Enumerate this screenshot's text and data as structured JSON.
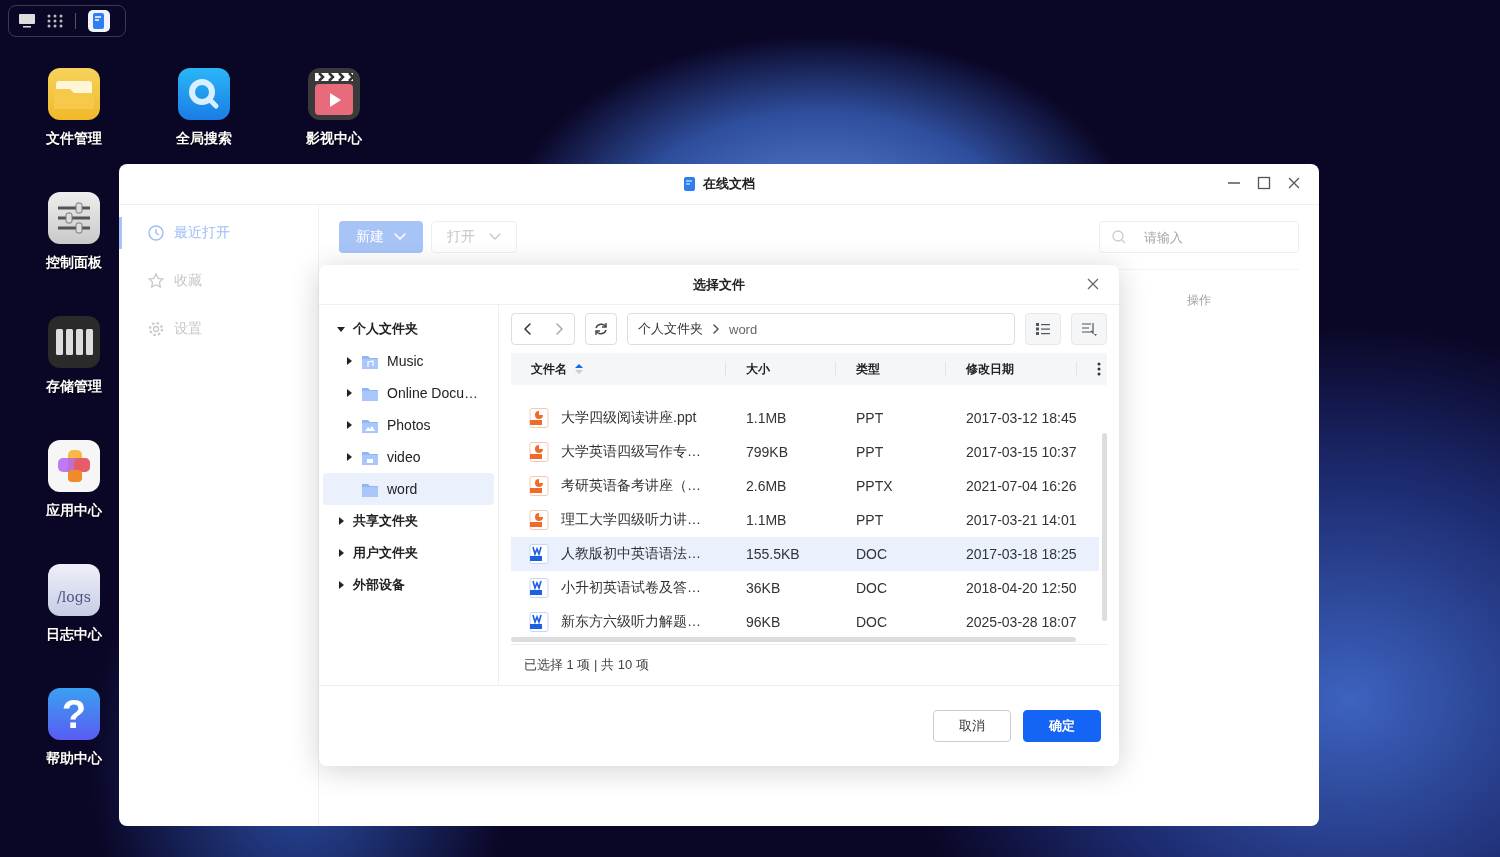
{
  "desktop_icons": [
    {
      "label": "文件管理",
      "kind": "folder"
    },
    {
      "label": "全局搜索",
      "kind": "search"
    },
    {
      "label": "影视中心",
      "kind": "video"
    },
    {
      "label": "控制面板",
      "kind": "control"
    },
    {
      "label": "存储管理",
      "kind": "storage"
    },
    {
      "label": "应用中心",
      "kind": "apps"
    },
    {
      "label": "日志中心",
      "kind": "logs",
      "text": "/logs"
    },
    {
      "label": "帮助中心",
      "kind": "help",
      "text": "?"
    }
  ],
  "window": {
    "title": "在线文档",
    "sidebar": [
      {
        "label": "最近打开",
        "kind": "clock",
        "selected": true
      },
      {
        "label": "收藏",
        "kind": "star",
        "selected": false
      },
      {
        "label": "设置",
        "kind": "gear",
        "selected": false
      }
    ],
    "new_button": "新建",
    "open_button": "打开",
    "search": {
      "placeholder": "请输入"
    },
    "table_columns": [
      "操作"
    ]
  },
  "dialog": {
    "title": "选择文件",
    "tree": [
      {
        "label": "个人文件夹",
        "expanded": true,
        "children": [
          {
            "label": "Music",
            "kind": "music",
            "expandable": true,
            "selected": false
          },
          {
            "label": "Online Docu…",
            "kind": "folder",
            "expandable": true,
            "selected": false
          },
          {
            "label": "Photos",
            "kind": "photos",
            "expandable": true,
            "selected": false
          },
          {
            "label": "video",
            "kind": "video",
            "expandable": true,
            "selected": false
          },
          {
            "label": "word",
            "kind": "folder",
            "expandable": false,
            "selected": true
          }
        ]
      },
      {
        "label": "共享文件夹",
        "expanded": false
      },
      {
        "label": "用户文件夹",
        "expanded": false
      },
      {
        "label": "外部设备",
        "expanded": false
      }
    ],
    "breadcrumb": [
      "个人文件夹",
      "word"
    ],
    "columns": [
      {
        "label": "文件名",
        "sorted": true
      },
      {
        "label": "大小",
        "sorted": false
      },
      {
        "label": "类型",
        "sorted": false
      },
      {
        "label": "修改日期",
        "sorted": false
      }
    ],
    "rows": [
      {
        "name": "大学四级阅读讲座.ppt",
        "size": "1.1MB",
        "type": "PPT",
        "date": "2017-03-12 18:45",
        "kind": "ppt",
        "selected": false
      },
      {
        "name": "大学英语四级写作专…",
        "size": "799KB",
        "type": "PPT",
        "date": "2017-03-15 10:37",
        "kind": "ppt",
        "selected": false
      },
      {
        "name": "考研英语备考讲座（…",
        "size": "2.6MB",
        "type": "PPTX",
        "date": "2021-07-04 16:26",
        "kind": "ppt",
        "selected": false
      },
      {
        "name": "理工大学四级听力讲…",
        "size": "1.1MB",
        "type": "PPT",
        "date": "2017-03-21 14:01",
        "kind": "ppt",
        "selected": false
      },
      {
        "name": "人教版初中英语语法…",
        "size": "155.5KB",
        "type": "DOC",
        "date": "2017-03-18 18:25",
        "kind": "doc",
        "selected": true
      },
      {
        "name": "小升初英语试卷及答…",
        "size": "36KB",
        "type": "DOC",
        "date": "2018-04-20 12:50",
        "kind": "doc",
        "selected": false
      },
      {
        "name": "新东方六级听力解题…",
        "size": "96KB",
        "type": "DOC",
        "date": "2025-03-28 18:07",
        "kind": "doc",
        "selected": false
      }
    ],
    "status": "已选择 1 项 | 共 10 项",
    "buttons": [
      {
        "label": "取消",
        "kind": "secondary"
      },
      {
        "label": "确定",
        "kind": "primary"
      }
    ]
  }
}
